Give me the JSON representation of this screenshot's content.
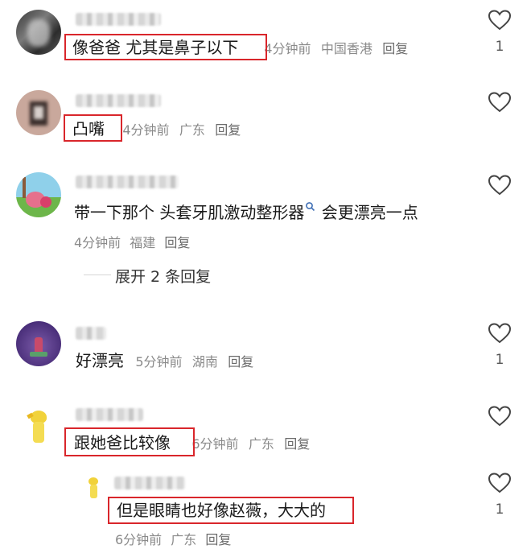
{
  "comments": [
    {
      "text": "像爸爸 尤其是鼻子以下",
      "time": "4分钟前",
      "location": "中国香港",
      "reply": "回复",
      "likes": "1"
    },
    {
      "text": "凸嘴",
      "time": "4分钟前",
      "location": "广东",
      "reply": "回复",
      "likes": ""
    },
    {
      "text": "带一下那个 头套牙肌激动整形器",
      "text_suffix": " 会更漂亮一点",
      "time": "4分钟前",
      "location": "福建",
      "reply": "回复",
      "likes": "",
      "expand": "展开 2 条回复"
    },
    {
      "text": "好漂亮",
      "time": "5分钟前",
      "location": "湖南",
      "reply": "回复",
      "likes": "1"
    },
    {
      "text": "跟她爸比较像",
      "time": "6分钟前",
      "location": "广东",
      "reply": "回复",
      "likes": ""
    },
    {
      "text": "但是眼睛也好像赵薇，大大的",
      "time": "6分钟前",
      "location": "广东",
      "reply": "回复",
      "likes": "1"
    }
  ],
  "icons": {
    "heart": "heart-outline-icon",
    "search_hint": "search-icon"
  },
  "colors": {
    "highlight_box": "#d9262b",
    "meta_text": "#8a8a8a"
  }
}
